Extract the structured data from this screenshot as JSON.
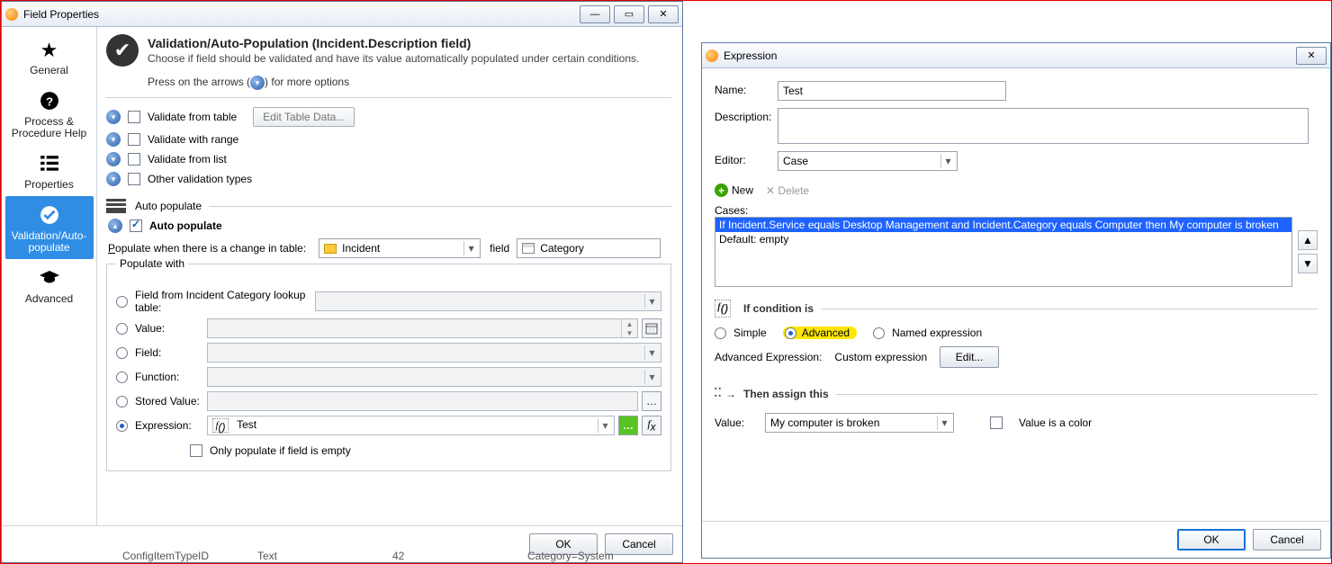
{
  "left": {
    "title": "Field Properties",
    "sidebar": [
      {
        "label": "General"
      },
      {
        "label": "Process & Procedure Help"
      },
      {
        "label": "Properties"
      },
      {
        "label": "Validation/Auto-populate"
      },
      {
        "label": "Advanced"
      }
    ],
    "header_title": "Validation/Auto-Population (Incident.Description field)",
    "header_sub": "Choose if field should be validated and have its value automatically populated under certain conditions.",
    "press": "Press on the arrows (",
    "press2": ") for more options",
    "opts": {
      "v_table": "Validate from table",
      "v_table_btn": "Edit Table Data...",
      "v_range": "Validate with range",
      "v_list": "Validate from list",
      "v_other": "Other validation types"
    },
    "auto": {
      "sect": "Auto populate",
      "chk": "Auto populate",
      "pop_lab_pre": "P",
      "pop_lab": "opulate when there is a change in table:",
      "incident": "Incident",
      "field_lbl": "field",
      "category": "Category",
      "with": "Populate with",
      "r_lookup": "Field from Incident Category lookup table:",
      "r_value": "Value:",
      "r_field": "Field:",
      "r_func": "Function:",
      "r_stored": "Stored Value:",
      "r_expr": "Expression:",
      "expr_val": "Test",
      "only_empty": "Only populate if field is empty"
    },
    "ok": "OK",
    "cancel": "Cancel"
  },
  "right": {
    "title": "Expression",
    "name_lab": "Name:",
    "name_u": "N",
    "name_val": "Test",
    "desc_lab": "Description:",
    "desc_u": "D",
    "editor_lab": "Editor:",
    "editor_u": "E",
    "editor_val": "Case",
    "new": "New",
    "delete": "Delete",
    "cases_lab": "Cases:",
    "cases_u": "C",
    "case1": "If Incident.Service equals Desktop Management and Incident.Category equals Computer then My computer is broken",
    "case2": "Default: empty",
    "cond_head": "If condition is",
    "simple": "Simple",
    "advanced": "Advanced",
    "named": "Named expression",
    "adv_lab": "Advanced Expression:",
    "adv_val": "Custom expression",
    "edit": "Edit...",
    "then": "Then assign this",
    "value_lab": "Value:",
    "value_val": "My computer is broken",
    "color": "Value is a color",
    "ok": "OK",
    "cancel": "Cancel"
  },
  "strip": {
    "a": "ConfigItemTypeID",
    "b": "Text",
    "c": "42",
    "d": "Category=System"
  }
}
